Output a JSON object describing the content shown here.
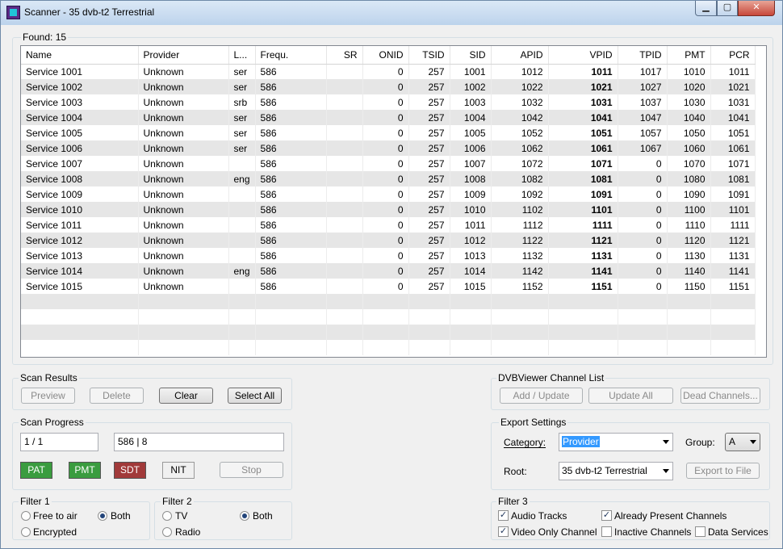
{
  "window": {
    "title": "Scanner - 35 dvb-t2 Terrestrial",
    "minimize_glyph": "▁",
    "maximize_glyph": "▢",
    "close_glyph": "✕"
  },
  "found": "Found: 15",
  "table": {
    "columns": [
      "Name",
      "Provider",
      "L...",
      "Frequ.",
      "SR",
      "ONID",
      "TSID",
      "SID",
      "APID",
      "VPID",
      "TPID",
      "PMT",
      "PCR"
    ],
    "rows": [
      [
        "Service 1001",
        "Unknown",
        "ser",
        "586",
        "",
        "0",
        "257",
        "1001",
        "1012",
        "1011",
        "1017",
        "1010",
        "1011"
      ],
      [
        "Service 1002",
        "Unknown",
        "ser",
        "586",
        "",
        "0",
        "257",
        "1002",
        "1022",
        "1021",
        "1027",
        "1020",
        "1021"
      ],
      [
        "Service 1003",
        "Unknown",
        "srb",
        "586",
        "",
        "0",
        "257",
        "1003",
        "1032",
        "1031",
        "1037",
        "1030",
        "1031"
      ],
      [
        "Service 1004",
        "Unknown",
        "ser",
        "586",
        "",
        "0",
        "257",
        "1004",
        "1042",
        "1041",
        "1047",
        "1040",
        "1041"
      ],
      [
        "Service 1005",
        "Unknown",
        "ser",
        "586",
        "",
        "0",
        "257",
        "1005",
        "1052",
        "1051",
        "1057",
        "1050",
        "1051"
      ],
      [
        "Service 1006",
        "Unknown",
        "ser",
        "586",
        "",
        "0",
        "257",
        "1006",
        "1062",
        "1061",
        "1067",
        "1060",
        "1061"
      ],
      [
        "Service 1007",
        "Unknown",
        "",
        "586",
        "",
        "0",
        "257",
        "1007",
        "1072",
        "1071",
        "0",
        "1070",
        "1071"
      ],
      [
        "Service 1008",
        "Unknown",
        "eng",
        "586",
        "",
        "0",
        "257",
        "1008",
        "1082",
        "1081",
        "0",
        "1080",
        "1081"
      ],
      [
        "Service 1009",
        "Unknown",
        "",
        "586",
        "",
        "0",
        "257",
        "1009",
        "1092",
        "1091",
        "0",
        "1090",
        "1091"
      ],
      [
        "Service 1010",
        "Unknown",
        "",
        "586",
        "",
        "0",
        "257",
        "1010",
        "1102",
        "1101",
        "0",
        "1100",
        "1101"
      ],
      [
        "Service 1011",
        "Unknown",
        "",
        "586",
        "",
        "0",
        "257",
        "1011",
        "1112",
        "1111",
        "0",
        "1110",
        "1111"
      ],
      [
        "Service 1012",
        "Unknown",
        "",
        "586",
        "",
        "0",
        "257",
        "1012",
        "1122",
        "1121",
        "0",
        "1120",
        "1121"
      ],
      [
        "Service 1013",
        "Unknown",
        "",
        "586",
        "",
        "0",
        "257",
        "1013",
        "1132",
        "1131",
        "0",
        "1130",
        "1131"
      ],
      [
        "Service 1014",
        "Unknown",
        "eng",
        "586",
        "",
        "0",
        "257",
        "1014",
        "1142",
        "1141",
        "0",
        "1140",
        "1141"
      ],
      [
        "Service 1015",
        "Unknown",
        "",
        "586",
        "",
        "0",
        "257",
        "1015",
        "1152",
        "1151",
        "0",
        "1150",
        "1151"
      ]
    ]
  },
  "scan_results": {
    "title": "Scan Results",
    "preview": "Preview",
    "delete": "Delete",
    "clear": "Clear",
    "select_all": "Select All"
  },
  "channel_list": {
    "title": "DVBViewer Channel List",
    "add_update": "Add / Update",
    "update_all": "Update All",
    "dead_channels": "Dead Channels..."
  },
  "scan_progress": {
    "title": "Scan Progress",
    "count": "1 / 1",
    "frequency": "586 | 8",
    "pat": "PAT",
    "pmt": "PMT",
    "sdt": "SDT",
    "nit": "NIT",
    "stop": "Stop"
  },
  "export": {
    "title": "Export Settings",
    "category_label": "Category:",
    "category_value": "Provider",
    "group_label": "Group:",
    "group_value": "A",
    "root_label": "Root:",
    "root_value": "35 dvb-t2 Terrestrial",
    "export_to_file": "Export to File"
  },
  "filter1": {
    "title": "Filter 1",
    "free_to_air": "Free to air",
    "both": "Both",
    "encrypted": "Encrypted"
  },
  "filter2": {
    "title": "Filter 2",
    "tv": "TV",
    "both": "Both",
    "radio": "Radio"
  },
  "filter3": {
    "title": "Filter 3",
    "audio_tracks": "Audio Tracks",
    "already_present": "Already Present Channels",
    "video_only": "Video Only Channel",
    "inactive": "Inactive Channels",
    "data_services": "Data Services",
    "check_glyph": "✓"
  },
  "colors": {
    "status_green": "#3a9c3f",
    "status_red": "#a13a3a",
    "selection": "#3399ff"
  }
}
